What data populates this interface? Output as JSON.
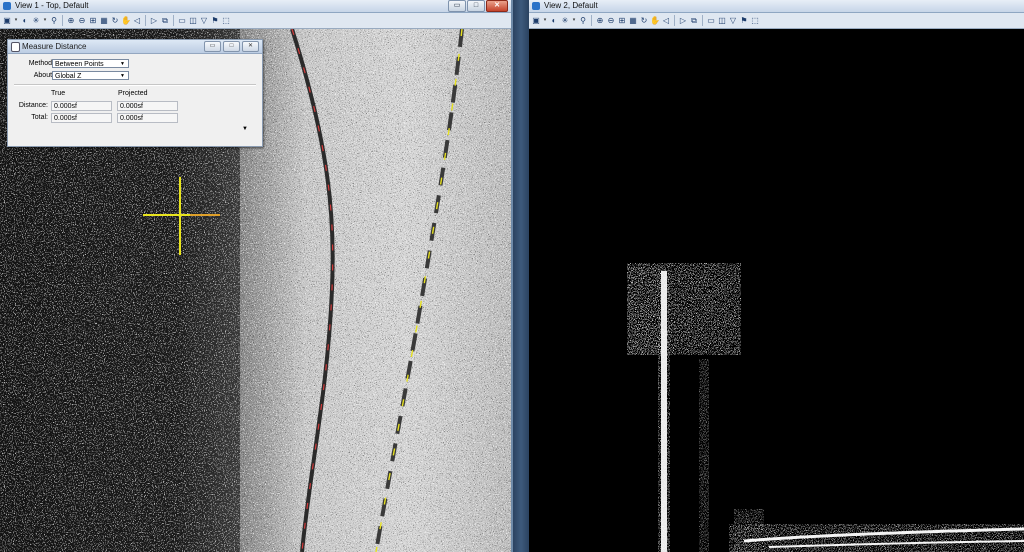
{
  "view1": {
    "title": "View 1 - Top, Default",
    "buttons": {
      "minimize": "▭",
      "maximize": "□",
      "close": "✕"
    }
  },
  "view2": {
    "title": "View 2, Default"
  },
  "toolbar_icons": [
    "view-attributes-icon",
    "dropdown-arrow-icon",
    "display-style-icon",
    "lighting-icon",
    "dropdown-arrow-icon",
    "update-view-icon",
    "zoom-in-icon",
    "zoom-out-icon",
    "fit-view-icon",
    "window-area-icon",
    "rotate-view-icon",
    "pan-view-icon",
    "view-previous-icon",
    "view-next-icon",
    "copy-view-icon",
    "clip-volume-icon",
    "clip-mask-icon",
    "camera-icon",
    "walk-icon",
    "toggle-3d-icon"
  ],
  "measure_distance": {
    "title": "Measure Distance",
    "method_label": "Method:",
    "method_value": "Between Points",
    "about_label": "About:",
    "about_value": "Global Z",
    "col_true": "True",
    "col_projected": "Projected",
    "distance_label": "Distance:",
    "distance_true": "0.000sf",
    "distance_projected": "0.000sf",
    "total_label": "Total:",
    "total_true": "0.000sf",
    "total_projected": "0.000sf"
  },
  "colors": {
    "lane_red": "#d23b3b",
    "lane_yellow": "#e6e020",
    "crosshair": "#e8e41e",
    "background_view2": "#000000"
  }
}
